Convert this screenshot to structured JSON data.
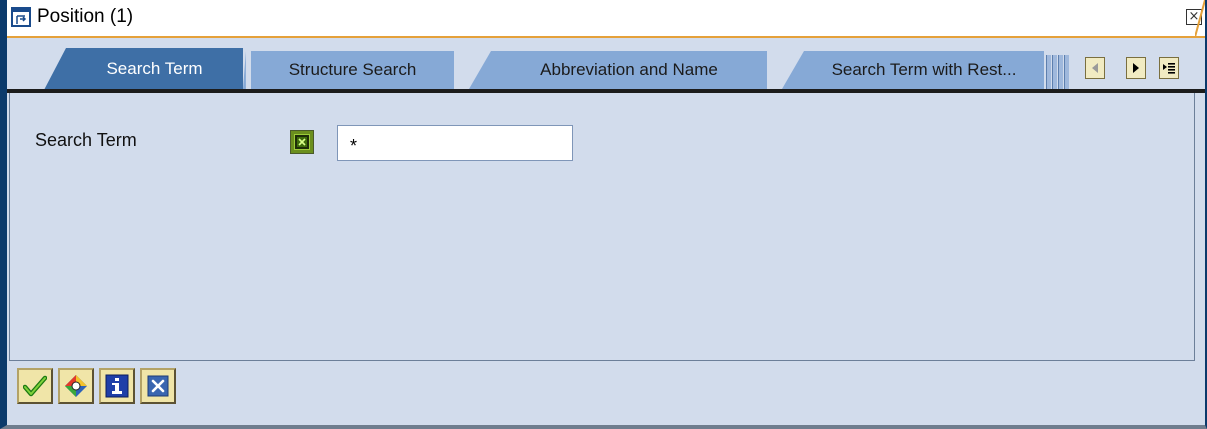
{
  "window": {
    "title": "Position (1)",
    "close_symbol": "×",
    "icon": "window-popup-icon"
  },
  "tabs": [
    {
      "label": "Search Term",
      "active": true
    },
    {
      "label": "Structure Search",
      "active": false
    },
    {
      "label": "Abbreviation and Name",
      "active": false
    },
    {
      "label": "Search Term with Rest...",
      "active": false
    }
  ],
  "tab_nav": {
    "prev_icon": "triangle-left-icon",
    "next_icon": "triangle-right-icon",
    "list_icon": "tab-list-icon"
  },
  "form": {
    "search_label": "Search Term",
    "search_value": "*",
    "matchcode_icon": "input-help-icon"
  },
  "toolbar": {
    "buttons": [
      {
        "name": "continue",
        "icon": "green-check-icon"
      },
      {
        "name": "search",
        "icon": "diamond-search-icon"
      },
      {
        "name": "info",
        "icon": "info-icon"
      },
      {
        "name": "cancel",
        "icon": "x-icon"
      }
    ]
  },
  "colors": {
    "accent": "#3e6fa6",
    "tab_inactive": "#86a9d6",
    "panel_bg": "#d2dcec",
    "button_bg": "#f0e5a8",
    "title_underline": "#e5a13a"
  }
}
